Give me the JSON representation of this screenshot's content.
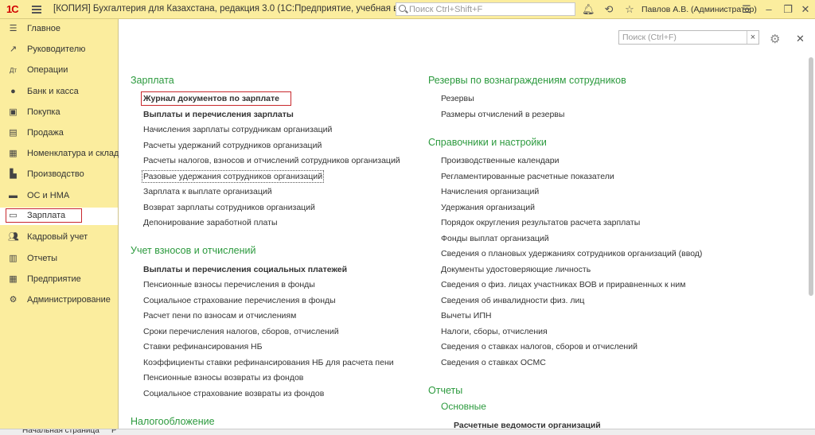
{
  "app": {
    "logo": "1С",
    "title": "[КОПИЯ] Бухгалтерия для Казахстана, редакция 3.0  (1С:Предприятие, учебная версия)",
    "search_placeholder": "Поиск Ctrl+Shift+F",
    "user": "Павлов А.В. (Администратор)"
  },
  "sidebar": {
    "items": [
      {
        "label": "Главное",
        "icon": "menu-icon"
      },
      {
        "label": "Руководителю",
        "icon": "chart-line-icon"
      },
      {
        "label": "Операции",
        "icon": "dt-kt-icon"
      },
      {
        "label": "Банк и касса",
        "icon": "coin-icon"
      },
      {
        "label": "Покупка",
        "icon": "cart-icon"
      },
      {
        "label": "Продажа",
        "icon": "shop-icon"
      },
      {
        "label": "Номенклатура и склад",
        "icon": "grid-icon"
      },
      {
        "label": "Производство",
        "icon": "factory-icon"
      },
      {
        "label": "ОС и НМА",
        "icon": "car-icon"
      },
      {
        "label": "Зарплата",
        "icon": "card-icon"
      },
      {
        "label": "Кадровый учет",
        "icon": "people-icon"
      },
      {
        "label": "Отчеты",
        "icon": "bar-chart-icon"
      },
      {
        "label": "Предприятие",
        "icon": "building-icon"
      },
      {
        "label": "Администрирование",
        "icon": "gear-icon"
      }
    ]
  },
  "main": {
    "search_placeholder": "Поиск (Ctrl+F)",
    "left": {
      "zarplata": {
        "title": "Зарплата",
        "links": [
          "Журнал документов по зарплате",
          "Выплаты и перечисления зарплаты",
          "Начисления зарплаты сотрудникам организаций",
          "Расчеты удержаний сотрудников организаций",
          "Расчеты налогов, взносов и отчислений сотрудников организаций",
          "Разовые удержания сотрудников организаций",
          "Зарплата к выплате организаций",
          "Возврат зарплаты сотрудников организаций",
          "Депонирование заработной платы"
        ]
      },
      "vznosy": {
        "title": "Учет взносов и отчислений",
        "links": [
          "Выплаты и перечисления социальных платежей",
          "Пенсионные взносы перечисления в фонды",
          "Социальное страхование перечисления в фонды",
          "Расчет пени по взносам и отчислениям",
          "Сроки перечисления налогов, сборов, отчислений",
          "Ставки рефинансирования НБ",
          "Коэффициенты ставки рефинансирования НБ для расчета пени",
          "Пенсионные взносы возвраты из фондов",
          "Социальное страхование возвраты из фондов"
        ]
      },
      "nalog": {
        "title": "Налогообложение"
      }
    },
    "right": {
      "rezervy": {
        "title": "Резервы по вознаграждениям сотрудников",
        "links": [
          "Резервы",
          "Размеры отчислений в резервы"
        ]
      },
      "spravochniki": {
        "title": "Справочники и настройки",
        "links": [
          "Производственные календари",
          "Регламентированные расчетные показатели",
          "Начисления организаций",
          "Удержания организаций",
          "Порядок округления результатов расчета зарплаты",
          "Фонды выплат организаций",
          "Сведения о плановых удержаниях сотрудников организаций (ввод)",
          "Документы удостоверяющие личность",
          "Сведения о физ. лицах участниках ВОВ и приравненных к ним",
          "Сведения об инвалидности физ. лиц",
          "Вычеты ИПН",
          "Налоги, сборы, отчисления",
          "Сведения о ставках налогов, сборов и отчислений",
          "Сведения о ставках ОСМС"
        ]
      },
      "otchety": {
        "title": "Отчеты",
        "subtitle": "Основные",
        "links": [
          "Расчетные ведомости организаций"
        ]
      }
    }
  },
  "bottom": {
    "tab1": "Начальная страница",
    "tab2": "Р"
  },
  "colors": {
    "accent": "#fbed9e",
    "section": "#2c9a3e",
    "highlight": "#c8282d"
  }
}
